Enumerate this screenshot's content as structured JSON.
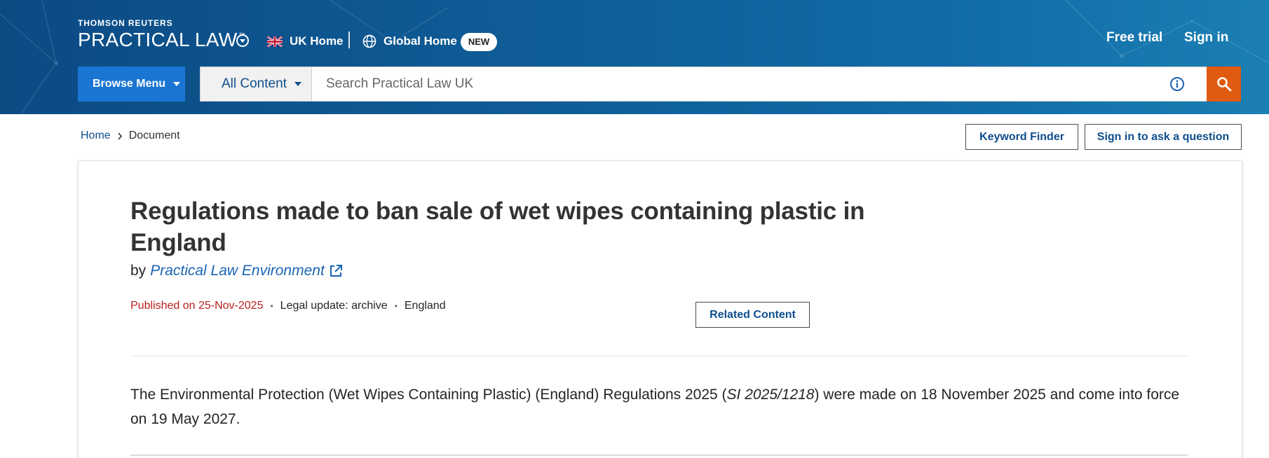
{
  "header": {
    "brand_top": "THOMSON REUTERS",
    "brand_main": "PRACTICAL LAW",
    "brand_tm": "™",
    "uk_home": "UK Home",
    "global_home": "Global Home",
    "new_badge": "NEW",
    "free_trial": "Free trial",
    "sign_in": "Sign in",
    "browse_menu": "Browse Menu",
    "all_content": "All Content",
    "search_placeholder": "Search Practical Law UK"
  },
  "breadcrumb": {
    "home": "Home",
    "current": "Document"
  },
  "utility": {
    "keyword_finder": "Keyword Finder",
    "ask_question": "Sign in to ask a question"
  },
  "document": {
    "title": "Regulations made to ban sale of wet wipes containing plastic in England",
    "by": "by",
    "author": "Practical Law Environment",
    "published": "Published on 25-Nov-2025",
    "dot": "•",
    "type": "Legal update: archive",
    "jurisdiction": "England",
    "related_content": "Related Content",
    "body_before": "The Environmental Protection (Wet Wipes Containing Plastic) (England) Regulations 2025 (",
    "body_citation": "SI 2025/1218",
    "body_after": ") were made on 18 November 2025 and come into force on 19 May 2027."
  },
  "colors": {
    "header_start": "#0c4a84",
    "header_end": "#1a7fb3",
    "browse_button": "#1b75d2",
    "search_button": "#e05a0f",
    "link": "#0f4f8c",
    "published": "#b81e1e"
  },
  "icons": [
    "brand-toggle-icon",
    "uk-flag-icon",
    "globe-icon",
    "info-icon",
    "search-icon",
    "chevron-right-icon",
    "external-link-icon"
  ]
}
